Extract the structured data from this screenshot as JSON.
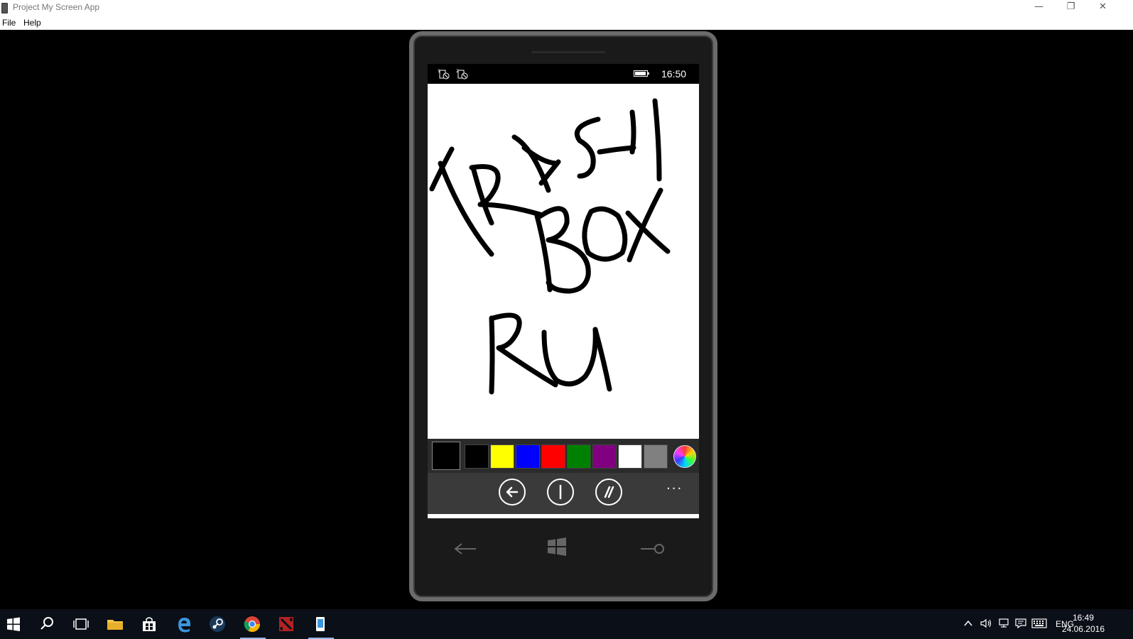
{
  "window": {
    "title": "Project My Screen App"
  },
  "menu": {
    "file": "File",
    "help": "Help"
  },
  "phone": {
    "statusbar": {
      "sim1": "1",
      "sim2": "2",
      "time": "16:50"
    },
    "canvas": {
      "drawing_text": [
        "TRASH",
        "BOX",
        "RU"
      ]
    },
    "palette": {
      "selected": "#000000",
      "colors": [
        "#000000",
        "#ffff00",
        "#0000ff",
        "#ff0000",
        "#008000",
        "#800080",
        "#ffffff",
        "#808080"
      ]
    },
    "appbar": {
      "more_label": "···"
    }
  },
  "taskbar": {
    "tray": {
      "language": "ENG",
      "time": "16:49",
      "date": "24.06.2016"
    }
  }
}
